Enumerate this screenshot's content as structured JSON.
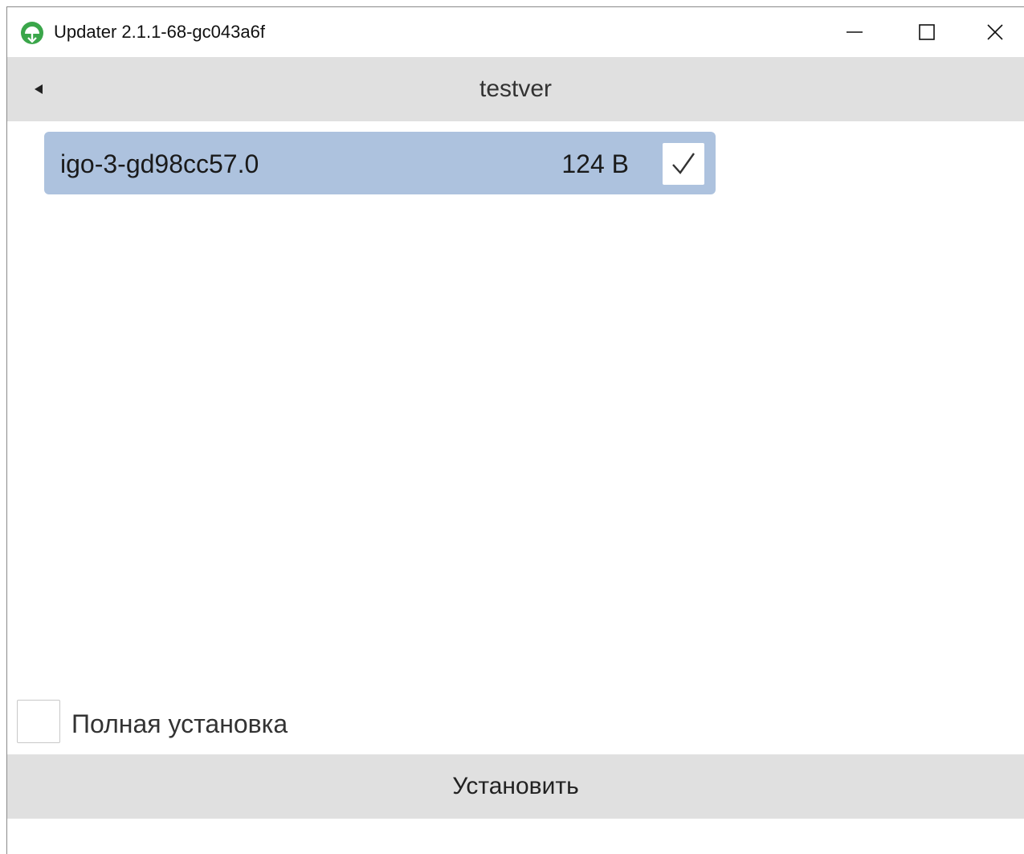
{
  "window": {
    "title": "Updater 2.1.1-68-gc043a6f",
    "controls": {
      "minimize_icon": "minimize-icon",
      "maximize_icon": "maximize-icon",
      "close_icon": "close-icon"
    }
  },
  "navbar": {
    "back_icon": "back-arrow-icon",
    "title": "testver"
  },
  "packages": [
    {
      "name": "igo-3-gd98cc57.0",
      "size": "124 B",
      "checked": true
    }
  ],
  "options": {
    "full_install_label": "Полная установка",
    "full_install_checked": false
  },
  "actions": {
    "install_label": "Установить"
  },
  "colors": {
    "selected_item": "#adc2de",
    "bar_background": "#e0e0e0",
    "app_icon_green": "#3aa64a"
  }
}
